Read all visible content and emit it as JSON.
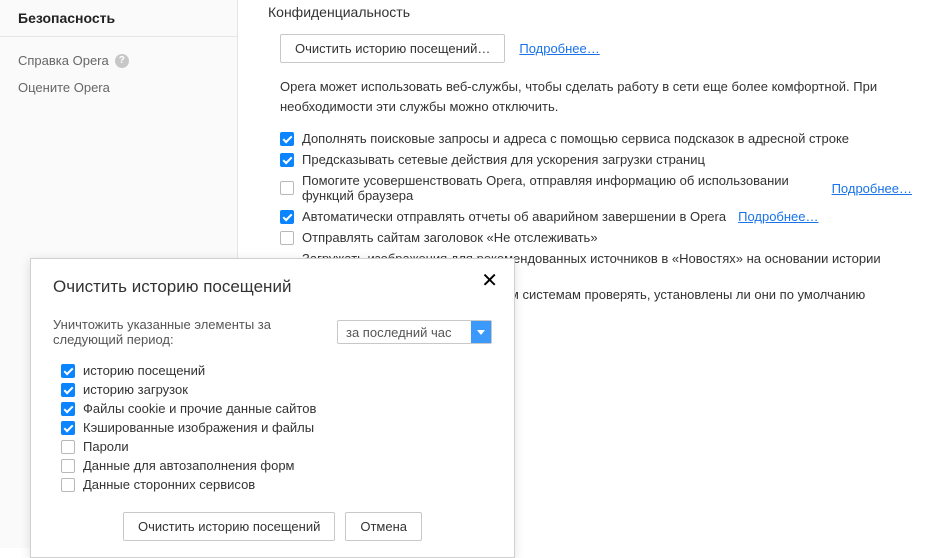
{
  "sidebar": {
    "title": "Безопасность",
    "links": [
      {
        "label": "Справка Opera",
        "help_icon": "?"
      },
      {
        "label": "Оцените Opera"
      }
    ]
  },
  "main": {
    "heading": "Конфиденциальность",
    "clear_button": "Очистить историю посещений…",
    "learn_more": "Подробнее…",
    "description": "Opera может использовать веб-службы, чтобы сделать работу в сети еще более комфортной. При необходимости эти службы можно отключить.",
    "privacy_items": [
      {
        "checked": true,
        "label": "Дополнять поисковые запросы и адреса с помощью сервиса подсказок в адресной строке",
        "link": null
      },
      {
        "checked": true,
        "label": "Предсказывать сетевые действия для ускорения загрузки страниц",
        "link": null
      },
      {
        "checked": false,
        "label": "Помогите усовершенствовать Opera, отправляя информацию об использовании функций браузера",
        "link": "Подробнее…"
      },
      {
        "checked": true,
        "label": "Автоматически отправлять отчеты об аварийном завершении в Opera",
        "link": "Подробнее…"
      },
      {
        "checked": false,
        "label": "Отправлять сайтам заголовок «Не отслеживать»",
        "link": null
      },
      {
        "checked": true,
        "label": "Загружать изображения для рекомендованных источников в «Новостях» на основании истории посещений",
        "link": null
      },
      {
        "checked": true,
        "label": "Разрешить партнерским поисковым системам проверять, установлены ли они по умолчанию",
        "link": null
      }
    ]
  },
  "dialog": {
    "title": "Очистить историю посещений",
    "period_label": "Уничтожить указанные элементы за следующий период:",
    "period_value": "за последний час",
    "items": [
      {
        "checked": true,
        "label": "историю посещений"
      },
      {
        "checked": true,
        "label": "историю загрузок"
      },
      {
        "checked": true,
        "label": "Файлы cookie и прочие данные сайтов"
      },
      {
        "checked": true,
        "label": "Кэшированные изображения и файлы"
      },
      {
        "checked": false,
        "label": "Пароли"
      },
      {
        "checked": false,
        "label": "Данные для автозаполнения форм"
      },
      {
        "checked": false,
        "label": "Данные сторонних сервисов"
      }
    ],
    "confirm": "Очистить историю посещений",
    "cancel": "Отмена"
  }
}
